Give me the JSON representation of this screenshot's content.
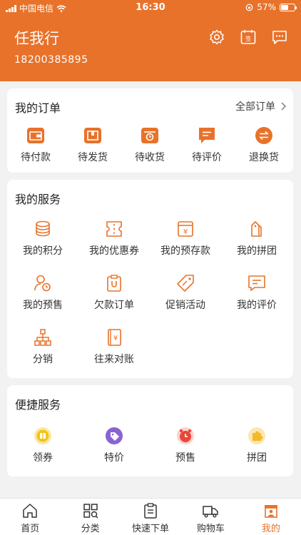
{
  "status": {
    "carrier": "中国电信",
    "time": "16:30",
    "battery": "57%",
    "battery_level": 0.57
  },
  "user": {
    "name": "任我行",
    "phone": "18200385895"
  },
  "header_icons": [
    "settings-icon",
    "calendar-sign-icon",
    "message-icon"
  ],
  "orders": {
    "title": "我的订单",
    "all_label": "全部订单",
    "items": [
      {
        "label": "待付款",
        "icon": "wallet-icon"
      },
      {
        "label": "待发货",
        "icon": "box-icon"
      },
      {
        "label": "待收货",
        "icon": "delivery-icon"
      },
      {
        "label": "待评价",
        "icon": "comment-icon"
      },
      {
        "label": "退换货",
        "icon": "exchange-icon"
      }
    ]
  },
  "services": {
    "title": "我的服务",
    "items": [
      {
        "label": "我的积分",
        "icon": "coins-icon"
      },
      {
        "label": "我的优惠券",
        "icon": "coupon-icon"
      },
      {
        "label": "我的预存款",
        "icon": "deposit-icon"
      },
      {
        "label": "我的拼团",
        "icon": "group-tag-icon"
      },
      {
        "label": "我的预售",
        "icon": "presale-user-icon"
      },
      {
        "label": "欠款订单",
        "icon": "debt-clipboard-icon"
      },
      {
        "label": "促销活动",
        "icon": "promo-tag-icon"
      },
      {
        "label": "我的评价",
        "icon": "review-icon"
      },
      {
        "label": "分销",
        "icon": "distribution-icon"
      },
      {
        "label": "往来对账",
        "icon": "ledger-icon"
      }
    ]
  },
  "quick": {
    "title": "便捷服务",
    "items": [
      {
        "label": "领券",
        "icon": "voucher-icon",
        "color": "#f3c31a"
      },
      {
        "label": "特价",
        "icon": "special-price-icon",
        "color": "#8a63d2"
      },
      {
        "label": "预售",
        "icon": "presale-clock-icon",
        "color": "#e8483b"
      },
      {
        "label": "拼团",
        "icon": "puzzle-icon",
        "color": "#f3b92a"
      }
    ]
  },
  "tabs": [
    {
      "label": "首页",
      "icon": "home-icon"
    },
    {
      "label": "分类",
      "icon": "category-icon"
    },
    {
      "label": "快速下单",
      "icon": "quick-order-icon"
    },
    {
      "label": "购物车",
      "icon": "cart-truck-icon"
    },
    {
      "label": "我的",
      "icon": "profile-shop-icon",
      "active": true
    }
  ],
  "colors": {
    "accent": "#e8722a"
  }
}
